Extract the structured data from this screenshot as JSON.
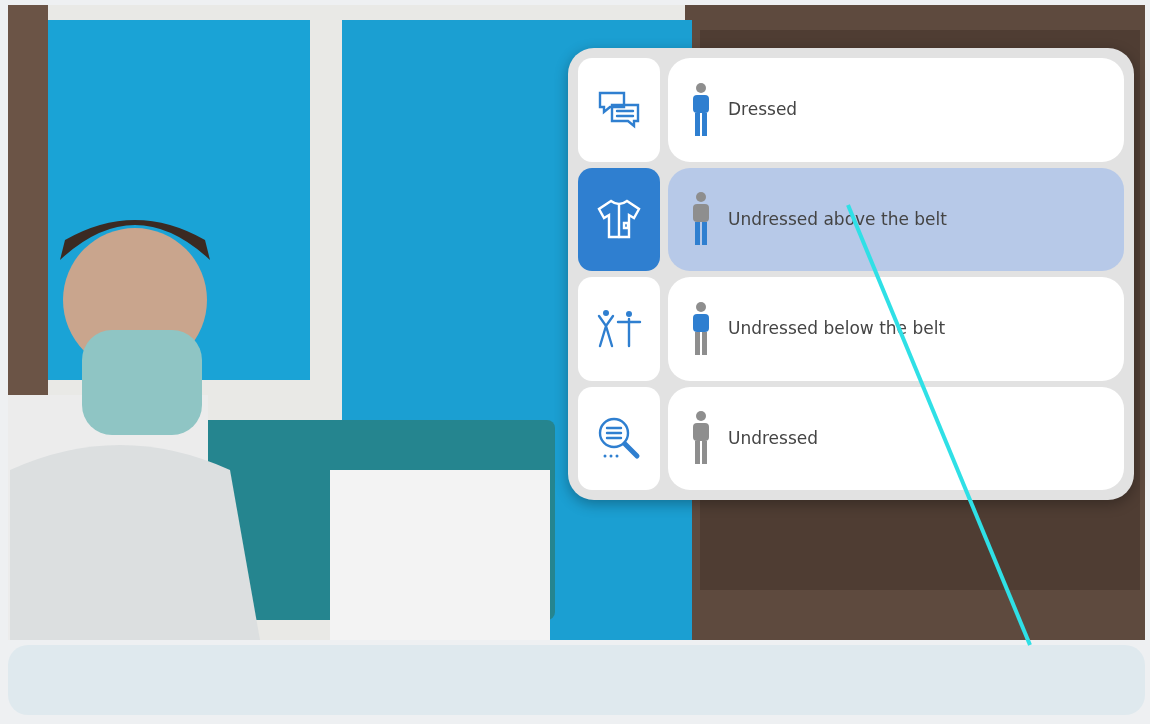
{
  "sidebar_tabs": [
    {
      "kind": "chat",
      "selected": false
    },
    {
      "kind": "shirt",
      "selected": true
    },
    {
      "kind": "figures",
      "selected": false
    },
    {
      "kind": "search",
      "selected": false
    }
  ],
  "options": [
    {
      "label": "Dressed",
      "kind": "full",
      "selected": false
    },
    {
      "label": "Undressed above the belt",
      "kind": "lower",
      "selected": true
    },
    {
      "label": "Undressed below the belt",
      "kind": "upper",
      "selected": false
    },
    {
      "label": "Undressed",
      "kind": "none",
      "selected": false
    }
  ]
}
